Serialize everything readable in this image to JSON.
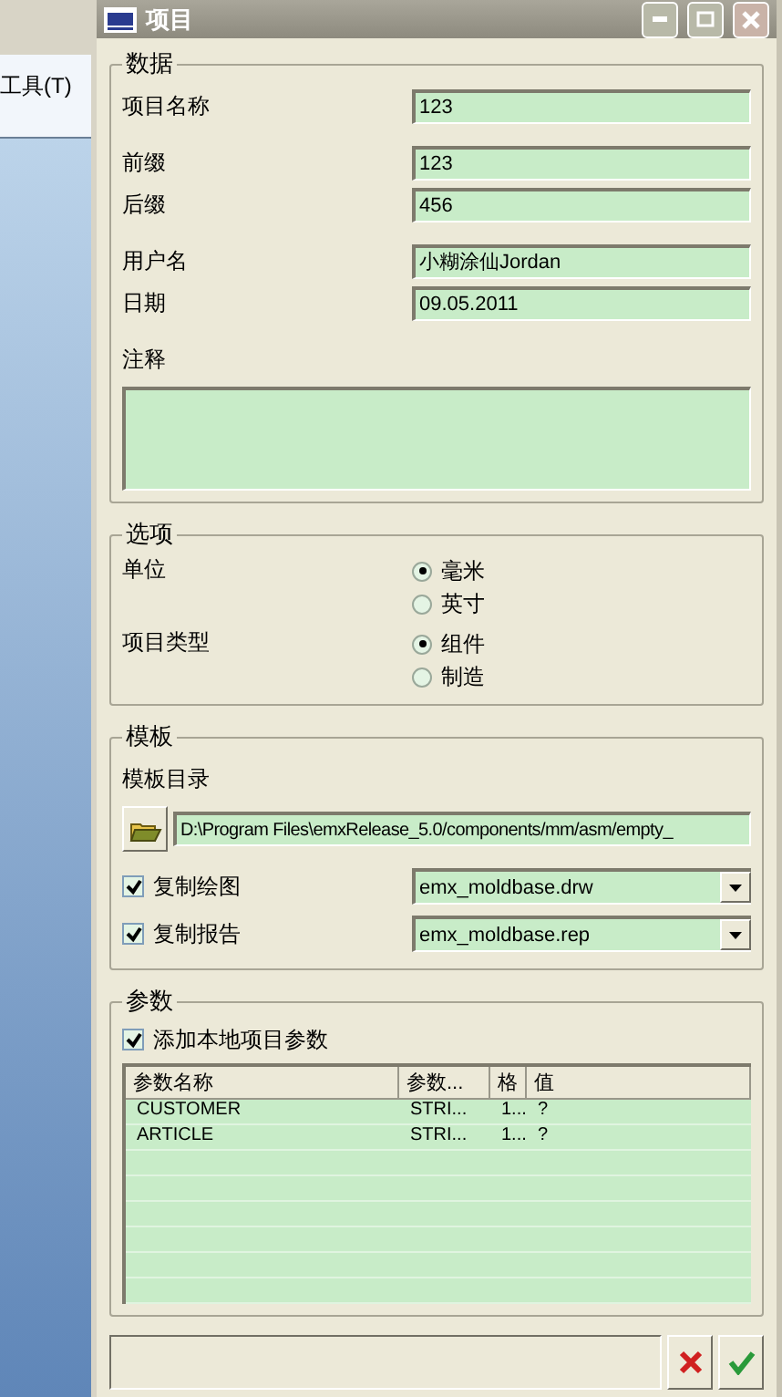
{
  "background_window": {
    "menu_item": "工具(T)"
  },
  "window": {
    "title": "项目"
  },
  "data_group": {
    "legend": "数据",
    "field_groups": [
      [
        {
          "label": "项目名称",
          "value": "123"
        }
      ],
      [
        {
          "label": "前缀",
          "value": "123"
        },
        {
          "label": "后缀",
          "value": "456"
        }
      ],
      [
        {
          "label": "用户名",
          "value": "小糊涂仙Jordan"
        },
        {
          "label": "日期",
          "value": "09.05.2011"
        }
      ]
    ],
    "notes_label": "注释"
  },
  "options_group": {
    "legend": "选项",
    "radio_groups": [
      {
        "label": "单位",
        "options": [
          {
            "label": "毫米",
            "selected": true
          },
          {
            "label": "英寸",
            "selected": false
          }
        ]
      },
      {
        "label": "项目类型",
        "options": [
          {
            "label": "组件",
            "selected": true
          },
          {
            "label": "制造",
            "selected": false
          }
        ]
      }
    ]
  },
  "template_group": {
    "legend": "模板",
    "directory_label": "模板目录",
    "directory_path": "D:\\Program Files\\emxRelease_5.0/components/mm/asm/empty_",
    "copies": [
      {
        "label": "复制绘图",
        "checked": true,
        "value": "emx_moldbase.drw"
      },
      {
        "label": "复制报告",
        "checked": true,
        "value": "emx_moldbase.rep"
      }
    ]
  },
  "parameters_group": {
    "legend": "参数",
    "add_local": {
      "label": "添加本地项目参数",
      "checked": true
    },
    "table": {
      "columns": [
        "参数名称",
        "参数...",
        "格",
        "值"
      ],
      "rows": [
        [
          "CUSTOMER",
          "STRI...",
          "1...",
          "?"
        ],
        [
          "ARTICLE",
          "STRI...",
          "1...",
          "?"
        ]
      ]
    }
  }
}
